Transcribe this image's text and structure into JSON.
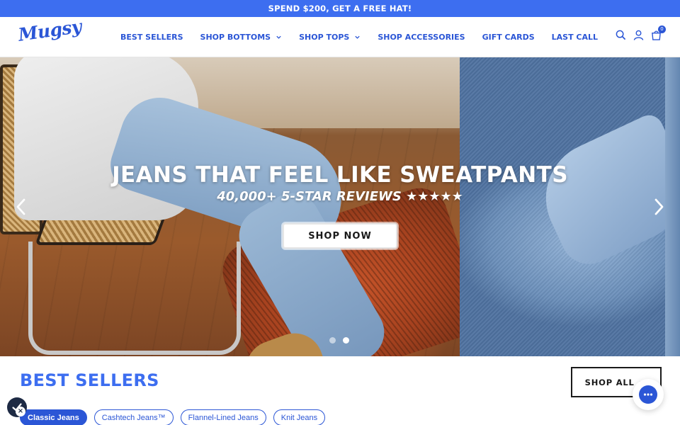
{
  "promo": {
    "text": "SPEND $200, GET A FREE HAT!"
  },
  "header": {
    "logo": "Mugsy",
    "nav": [
      {
        "label": "BEST SELLERS",
        "has_dropdown": false
      },
      {
        "label": "SHOP BOTTOMS",
        "has_dropdown": true
      },
      {
        "label": "SHOP TOPS",
        "has_dropdown": true
      },
      {
        "label": "SHOP ACCESSORIES",
        "has_dropdown": false
      },
      {
        "label": "GIFT CARDS",
        "has_dropdown": false
      },
      {
        "label": "LAST CALL",
        "has_dropdown": false
      }
    ],
    "icons": {
      "search": "search-icon",
      "account": "account-icon",
      "cart": "cart-icon"
    },
    "cart_count": "0"
  },
  "hero": {
    "title": "JEANS THAT FEEL LIKE SWEATPANTS",
    "subtitle": "40,000+ 5-STAR REVIEWS ★★★★★",
    "cta_label": "SHOP NOW",
    "slide_count": 2,
    "active_slide": 2
  },
  "best_sellers": {
    "title": "BEST SELLERS",
    "shop_all_label": "SHOP ALL",
    "filters": [
      {
        "label": "Classic Jeans",
        "active": true
      },
      {
        "label": "Cashtech Jeans™",
        "active": false
      },
      {
        "label": "Flannel-Lined Jeans",
        "active": false
      },
      {
        "label": "Knit Jeans",
        "active": false
      }
    ]
  },
  "colors": {
    "brand_blue": "#3d6ef0",
    "nav_blue": "#2b56d6",
    "white": "#ffffff",
    "dark": "#1a1a1a"
  }
}
